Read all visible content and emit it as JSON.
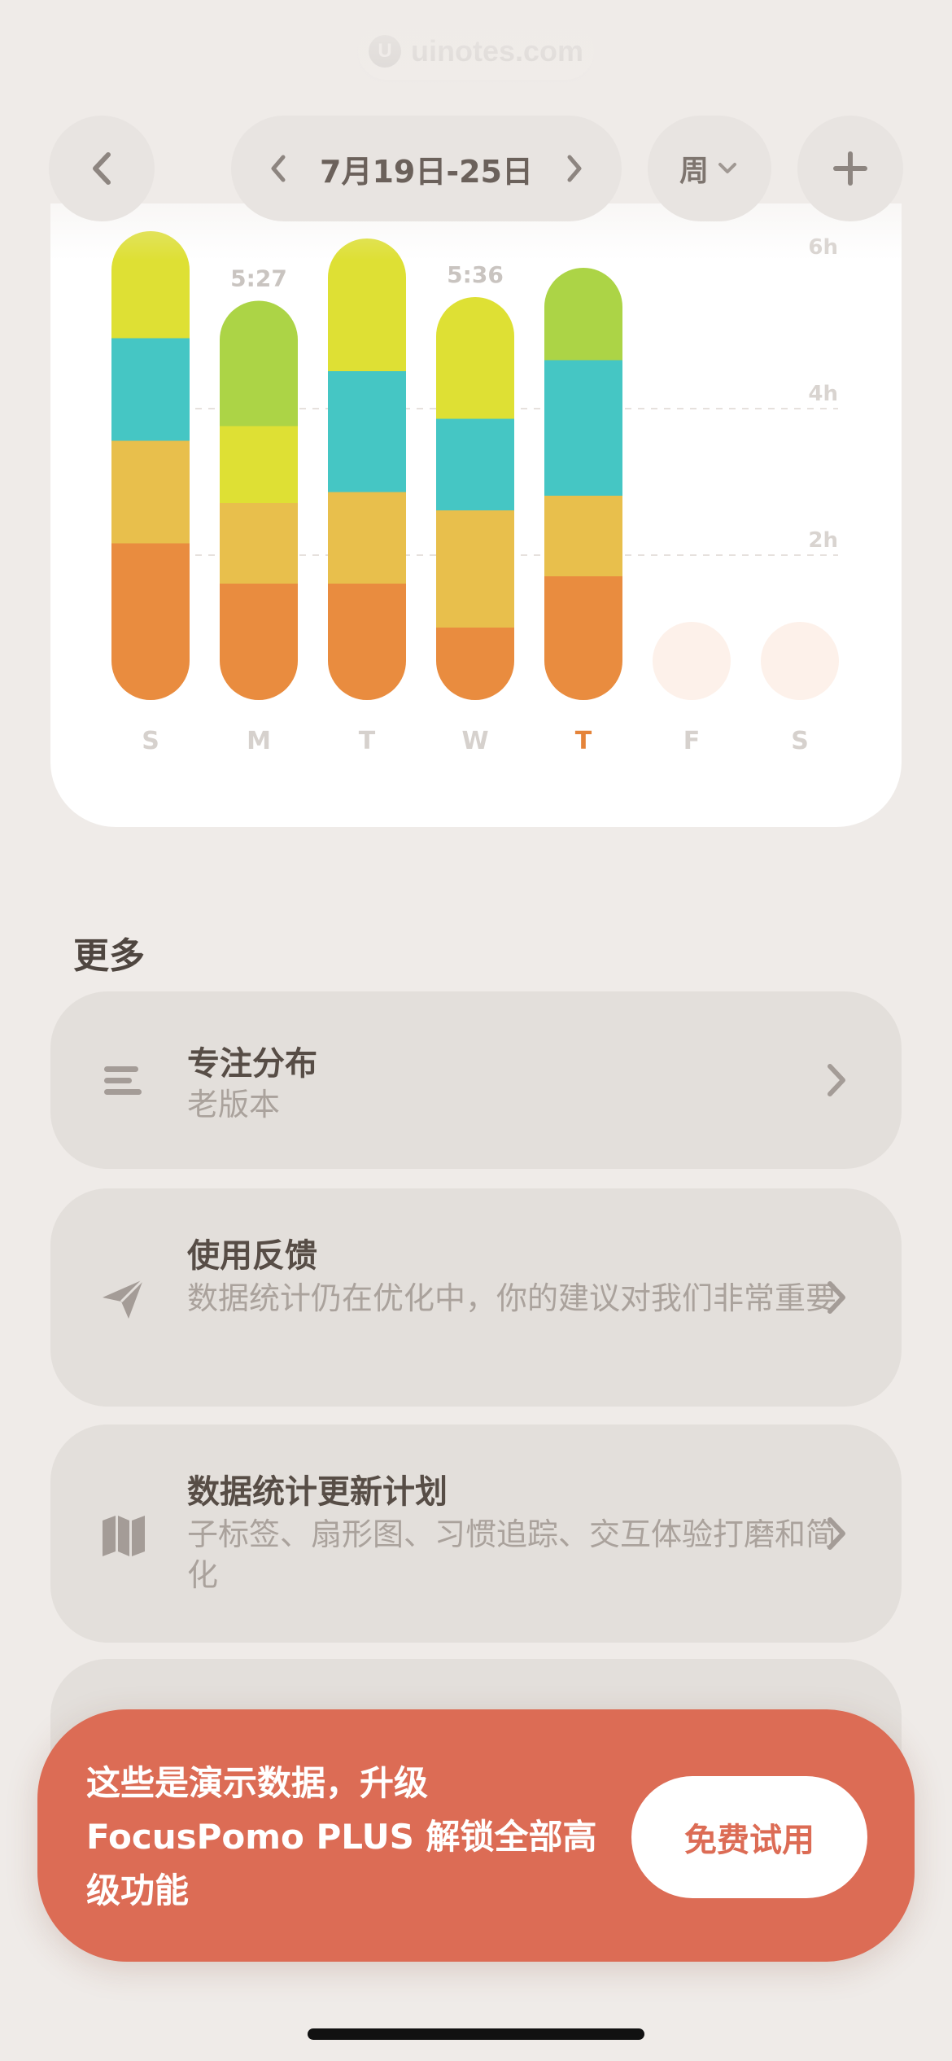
{
  "watermark": {
    "text": "uinotes.com"
  },
  "nav": {
    "back_icon": "chevron-left-icon",
    "prev_icon": "chevron-left-icon",
    "week_label": "7月19日-25日",
    "next_icon": "chevron-right-icon",
    "period_label": "周",
    "period_icon": "chevron-down-icon",
    "add_icon": "plus-icon"
  },
  "chart_data": {
    "type": "bar",
    "stacked": true,
    "categories": [
      "S",
      "M",
      "T",
      "W",
      "T",
      "F",
      "S"
    ],
    "highlight_index": 4,
    "y_tick_labels": [
      "6h",
      "4h",
      "2h"
    ],
    "y_ticks_hours": [
      6,
      4,
      2
    ],
    "bar_value_labels": [
      "",
      "5:27",
      "",
      "5:36",
      "",
      "",
      ""
    ],
    "segment_colors": [
      "#e98c3f",
      "#e8bf4c",
      "#45c6c4",
      "#dee034",
      "#acd446"
    ],
    "series": [
      {
        "color": "#e98c3f",
        "values": [
          2.15,
          1.6,
          1.6,
          1.0,
          1.7,
          0,
          0
        ]
      },
      {
        "color": "#e8bf4c",
        "values": [
          1.4,
          1.1,
          1.25,
          1.6,
          1.1,
          0,
          0
        ]
      },
      {
        "color": "#45c6c4",
        "values": [
          1.4,
          0,
          1.65,
          1.25,
          1.85,
          0,
          0
        ]
      },
      {
        "color": "#dee034",
        "values": [
          1.45,
          1.05,
          1.8,
          1.65,
          0,
          0,
          0
        ]
      },
      {
        "color": "#acd446",
        "values": [
          0,
          1.7,
          0,
          0,
          1.25,
          0,
          0
        ]
      }
    ],
    "ylim": [
      0,
      6.7
    ],
    "grid": true,
    "empty_day_color": "#fdf1ea"
  },
  "more": {
    "title": "更多",
    "items": [
      {
        "title": "专注分布",
        "subtitle": "老版本",
        "icon": "list-lines-icon"
      },
      {
        "title": "使用反馈",
        "subtitle": "数据统计仍在优化中，你的建议对我们非常重要",
        "icon": "paper-plane-icon"
      },
      {
        "title": "数据统计更新计划",
        "subtitle": "子标签、扇形图、习惯追踪、交互体验打磨和简化",
        "icon": "map-icon"
      }
    ]
  },
  "promo": {
    "text": "这些是演示数据，升级 FocusPomo PLUS 解锁全部高级功能",
    "button": "免费试用",
    "color": "#dc6c55"
  }
}
